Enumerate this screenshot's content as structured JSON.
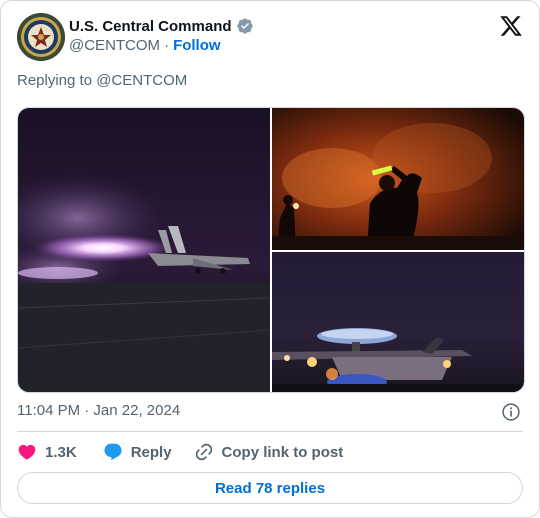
{
  "author": {
    "name": "U.S. Central Command",
    "handle": "@CENTCOM",
    "separator": "·",
    "follow_label": "Follow",
    "verified": true,
    "avatar_icon": "centcom-seal-icon"
  },
  "replying_to": "Replying to @CENTCOM",
  "media": [
    {
      "icon": "jet-launch-photo"
    },
    {
      "icon": "deck-crew-signaling-photo"
    },
    {
      "icon": "e2-hawkeye-aircraft-photo"
    }
  ],
  "timestamp": "11:04 PM · Jan 22, 2024",
  "actions": {
    "like_count": "1.3K",
    "reply_label": "Reply",
    "copy_label": "Copy link to post"
  },
  "read_replies_label": "Read 78 replies",
  "colors": {
    "accent": "#006fd6",
    "like": "#f91880",
    "reply_icon": "#1d9bf0",
    "muted_text": "#536471",
    "border": "#cfd9de"
  }
}
